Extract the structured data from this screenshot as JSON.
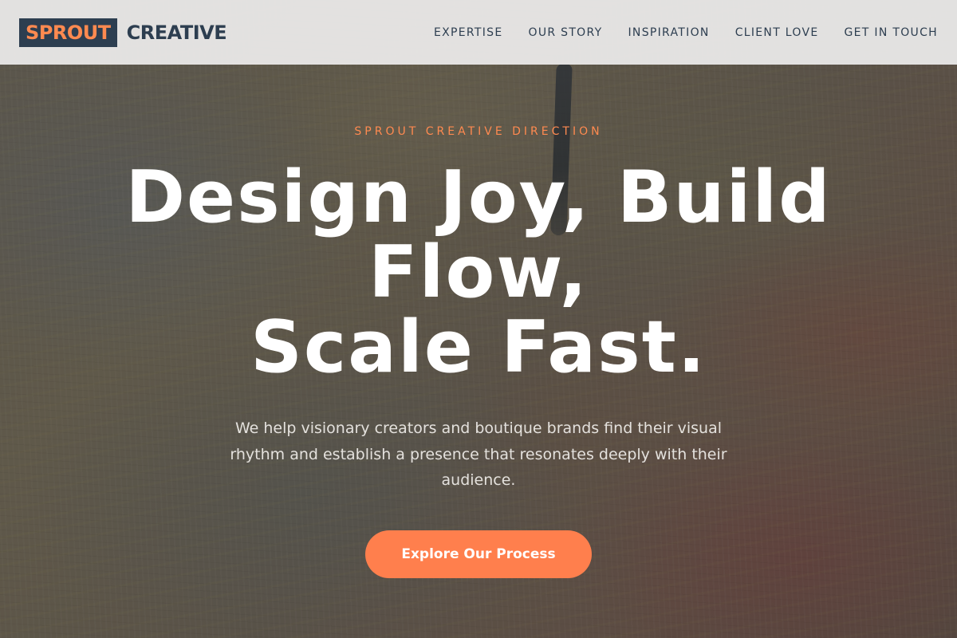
{
  "header": {
    "logo_box": "SPROUT",
    "logo_text": "CREATIVE",
    "nav": [
      {
        "label": "EXPERTISE"
      },
      {
        "label": "OUR STORY"
      },
      {
        "label": "INSPIRATION"
      },
      {
        "label": "CLIENT LOVE"
      },
      {
        "label": "GET IN TOUCH"
      }
    ]
  },
  "hero": {
    "eyebrow": "SPROUT CREATIVE DIRECTION",
    "headline_lines": [
      "Design Joy, Build",
      "Flow,",
      "Scale Fast."
    ],
    "subtext": "We help visionary creators and boutique brands find their visual rhythm and establish a presence that resonates deeply with their audience.",
    "cta_label": "Explore Our Process"
  },
  "colors": {
    "accent": "#ff8a50",
    "navy": "#2d3e50",
    "button": "#ff7f4d"
  }
}
